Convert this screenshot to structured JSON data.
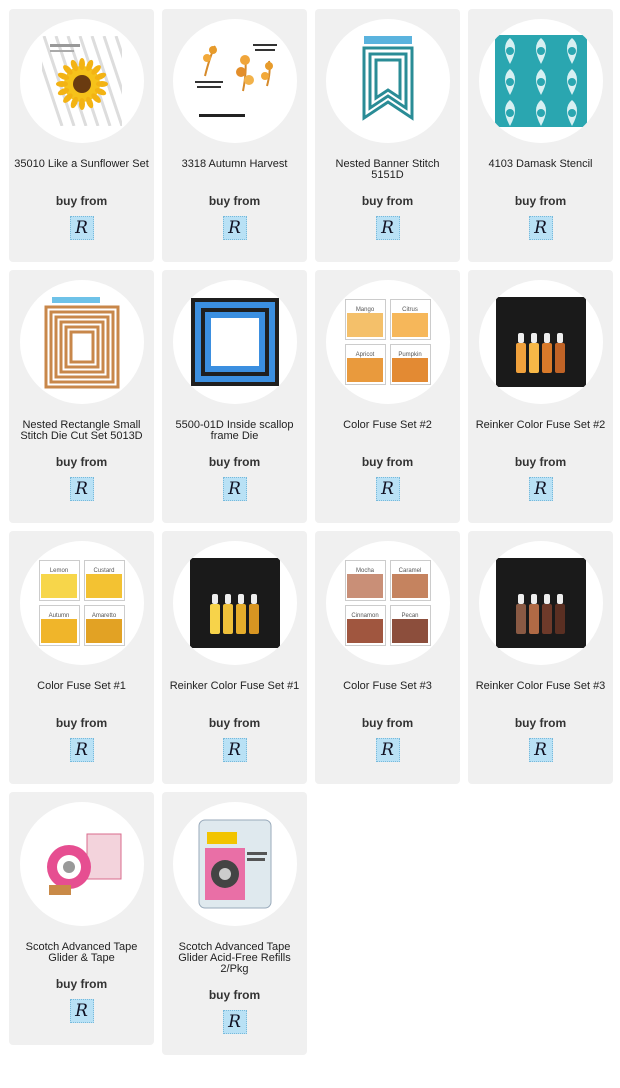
{
  "buy_label": "buy from",
  "logo_letter": "R",
  "products": [
    {
      "title": "35010 Like a Sunflower Set",
      "thumb": "sunflower"
    },
    {
      "title": "3318 Autumn Harvest",
      "thumb": "autumn"
    },
    {
      "title": "Nested Banner Stitch 5151D",
      "thumb": "banner"
    },
    {
      "title": "4103 Damask Stencil",
      "thumb": "damask"
    },
    {
      "title": "Nested Rectangle Small Stitch Die Cut Set 5013D",
      "thumb": "rect-orange"
    },
    {
      "title": "5500-01D Inside scallop frame Die",
      "thumb": "rect-blue"
    },
    {
      "title": "Color Fuse Set #2",
      "thumb": "swatch2"
    },
    {
      "title": "Reinker Color Fuse Set #2",
      "thumb": "reinker2"
    },
    {
      "title": "Color Fuse Set #1",
      "thumb": "swatch1"
    },
    {
      "title": "Reinker Color Fuse Set #1",
      "thumb": "reinker1"
    },
    {
      "title": "Color Fuse Set #3",
      "thumb": "swatch3"
    },
    {
      "title": "Reinker Color Fuse Set #3",
      "thumb": "reinker3"
    },
    {
      "title": "Scotch Advanced Tape Glider & Tape",
      "thumb": "tape"
    },
    {
      "title": "Scotch Advanced Tape Glider Acid-Free Refills 2/Pkg",
      "thumb": "refill"
    }
  ],
  "swatch_labels": {
    "swatch2": [
      "Mango",
      "Citrus",
      "Apricot",
      "Pumpkin"
    ],
    "swatch1": [
      "Lemon",
      "Custard",
      "Autumn",
      "Amaretto"
    ],
    "swatch3": [
      "Mocha",
      "Caramel",
      "Cinnamon",
      "Pecan"
    ]
  },
  "colors": {
    "card_bg": "#f0f0f0",
    "logo_bg": "#b9e1f5",
    "swatch2": [
      "#f4c06a",
      "#f6b75a",
      "#e99a3d",
      "#e38a33"
    ],
    "swatch1": [
      "#f7d64a",
      "#f3c232",
      "#f0b52a",
      "#e2a224"
    ],
    "swatch3": [
      "#c98f77",
      "#c5835f",
      "#a0563f",
      "#8c4e3c"
    ],
    "reinker2": [
      "#f0a13c",
      "#f7b847",
      "#d97a2a",
      "#c06326"
    ],
    "reinker1": [
      "#f7d34a",
      "#efc03a",
      "#e6ad2b",
      "#d89522"
    ],
    "reinker3": [
      "#8a5a44",
      "#b06a45",
      "#6e3a2a",
      "#5a2f22"
    ]
  }
}
